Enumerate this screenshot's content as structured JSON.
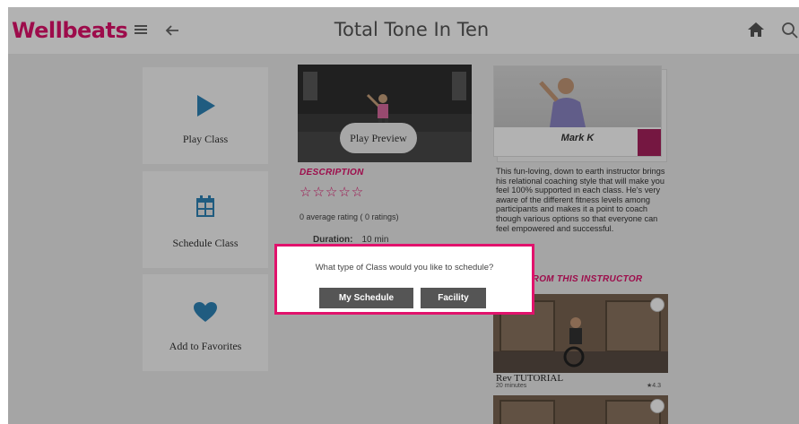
{
  "header": {
    "logo": "Wellbeats",
    "title": "Total Tone In Ten"
  },
  "actions": {
    "play_label": "Play Class",
    "schedule_label": "Schedule Class",
    "favorite_label": "Add to Favorites"
  },
  "class": {
    "preview_label": "Play Preview",
    "description_heading": "DESCRIPTION",
    "stars": "☆☆☆☆☆",
    "rating_text": "0 average rating ( 0 ratings)",
    "duration_label": "Duration:",
    "duration_value": "10 min"
  },
  "instructor": {
    "name": "Mark K",
    "bio": "This fun-loving, down to earth instructor brings his relational coaching style that will make you feel 100% supported in each class. He's very aware of the different fitness levels among participants and makes it a point to coach though various options so that everyone can feel empowered and successful.",
    "more_heading": "MORE FROM THIS INSTRUCTOR"
  },
  "related_classes": [
    {
      "title": "Rev TUTORIAL",
      "meta": "20 minutes",
      "rating": "★4.3"
    }
  ],
  "modal": {
    "question": "What type of Class would you like to schedule?",
    "my_schedule_label": "My Schedule",
    "facility_label": "Facility"
  },
  "colors": {
    "brand": "#e1126c",
    "accent_blue": "#2f84b8",
    "button_dark": "#555555"
  }
}
